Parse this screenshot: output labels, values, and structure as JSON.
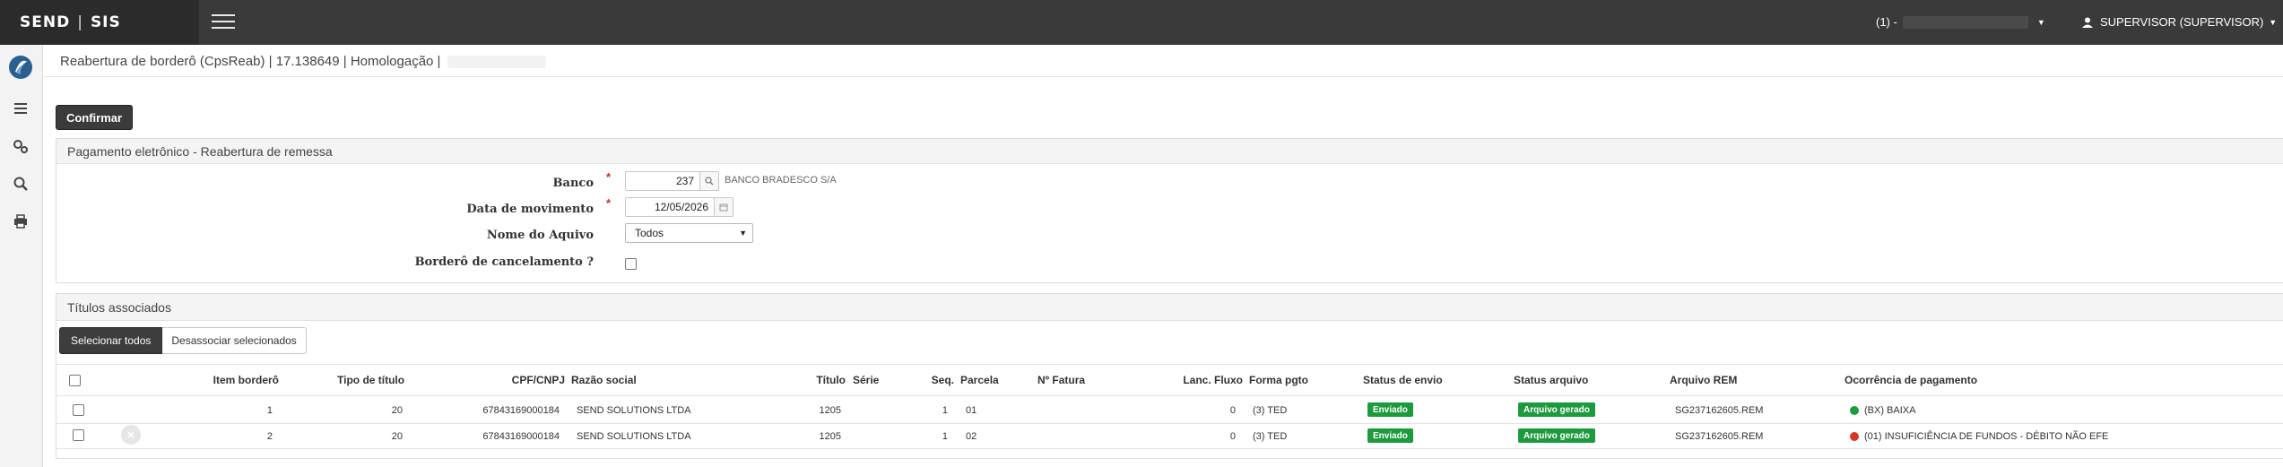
{
  "app": {
    "logo_left": "SEND",
    "logo_sep": "|",
    "logo_right": "SIS"
  },
  "header": {
    "company_prefix": "(1) -",
    "user_label": "SUPERVISOR (SUPERVISOR)"
  },
  "sidebar": {
    "items": [
      "list-icon",
      "settings-icon",
      "search-icon",
      "print-icon"
    ]
  },
  "breadcrumb": "Reabertura de borderô (CpsReab) | 17.138649 | Homologação |",
  "actions": {
    "confirm_label": "Confirmar"
  },
  "form": {
    "section_title": "Pagamento eletrônico - Reabertura de remessa",
    "banco_label": "Banco",
    "banco_value": "237",
    "banco_name": "BANCO BRADESCO S/A",
    "data_label": "Data de movimento",
    "data_value": "12/05/2026",
    "arquivo_label": "Nome do Aquivo",
    "arquivo_value": "Todos",
    "cancelamento_label": "Borderô de cancelamento ?",
    "required_mark": "*"
  },
  "titulos": {
    "section_title": "Títulos associados",
    "select_all_label": "Selecionar todos",
    "unselect_label": "Desassociar selecionados",
    "columns": [
      "Item borderô",
      "Tipo de título",
      "CPF/CNPJ",
      "Razão social",
      "Título",
      "Série",
      "Seq.",
      "Parcela",
      "Nº Fatura",
      "Lanc. Fluxo",
      "Forma pgto",
      "Status de envio",
      "Status arquivo",
      "Arquivo REM",
      "Ocorrência de pagamento"
    ],
    "rows": [
      {
        "item": "1",
        "tipo": "20",
        "cnpj": "67843169000184",
        "razao": "SEND SOLUTIONS LTDA",
        "titulo": "1205",
        "serie": "",
        "seq": "1",
        "parcela": "01",
        "fatura": "",
        "lanc": "0",
        "forma": "(3) TED",
        "status_envio": "Enviado",
        "status_arquivo": "Arquivo gerado",
        "arquivo": "SG237162605.REM",
        "ocorrencia": "(BX) BAIXA",
        "ocorrencia_color": "#1e9a3e"
      },
      {
        "item": "2",
        "tipo": "20",
        "cnpj": "67843169000184",
        "razao": "SEND SOLUTIONS LTDA",
        "titulo": "1205",
        "serie": "",
        "seq": "1",
        "parcela": "02",
        "fatura": "",
        "lanc": "0",
        "forma": "(3) TED",
        "status_envio": "Enviado",
        "status_arquivo": "Arquivo gerado",
        "arquivo": "SG237162605.REM",
        "ocorrencia": "(01) INSUFICIÊNCIA DE FUNDOS - DÉBITO NÃO EFE",
        "ocorrencia_color": "#d9342b"
      }
    ]
  },
  "colors": {
    "topbar": "#3a3a3a",
    "badge_green": "#1e9a3e",
    "required": "#d32f2f"
  }
}
